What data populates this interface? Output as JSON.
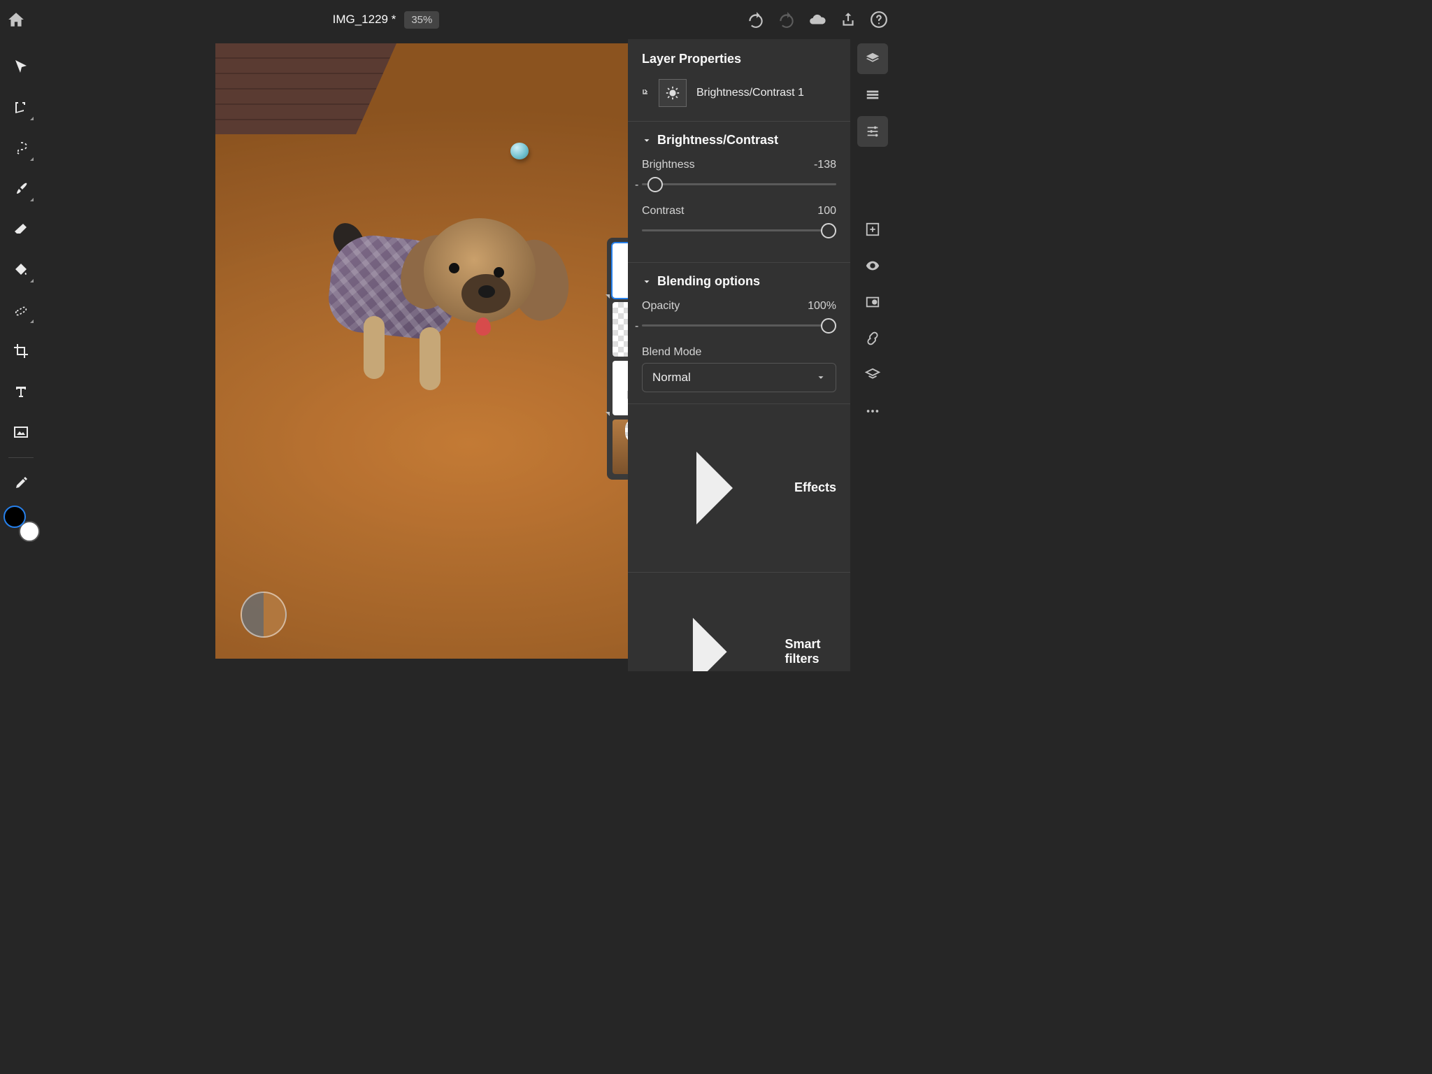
{
  "document": {
    "title": "IMG_1229 *",
    "zoom": "35%"
  },
  "panel": {
    "title": "Layer Properties",
    "layer_name": "Brightness/Contrast 1",
    "sections": {
      "brightness_contrast": {
        "title": "Brightness/Contrast",
        "brightness_label": "Brightness",
        "brightness_value": "-138",
        "contrast_label": "Contrast",
        "contrast_value": "100"
      },
      "blending": {
        "title": "Blending options",
        "opacity_label": "Opacity",
        "opacity_value": "100%",
        "blendmode_label": "Blend Mode",
        "blendmode_value": "Normal"
      },
      "effects": {
        "title": "Effects"
      },
      "smartfilters": {
        "title": "Smart filters"
      }
    }
  }
}
